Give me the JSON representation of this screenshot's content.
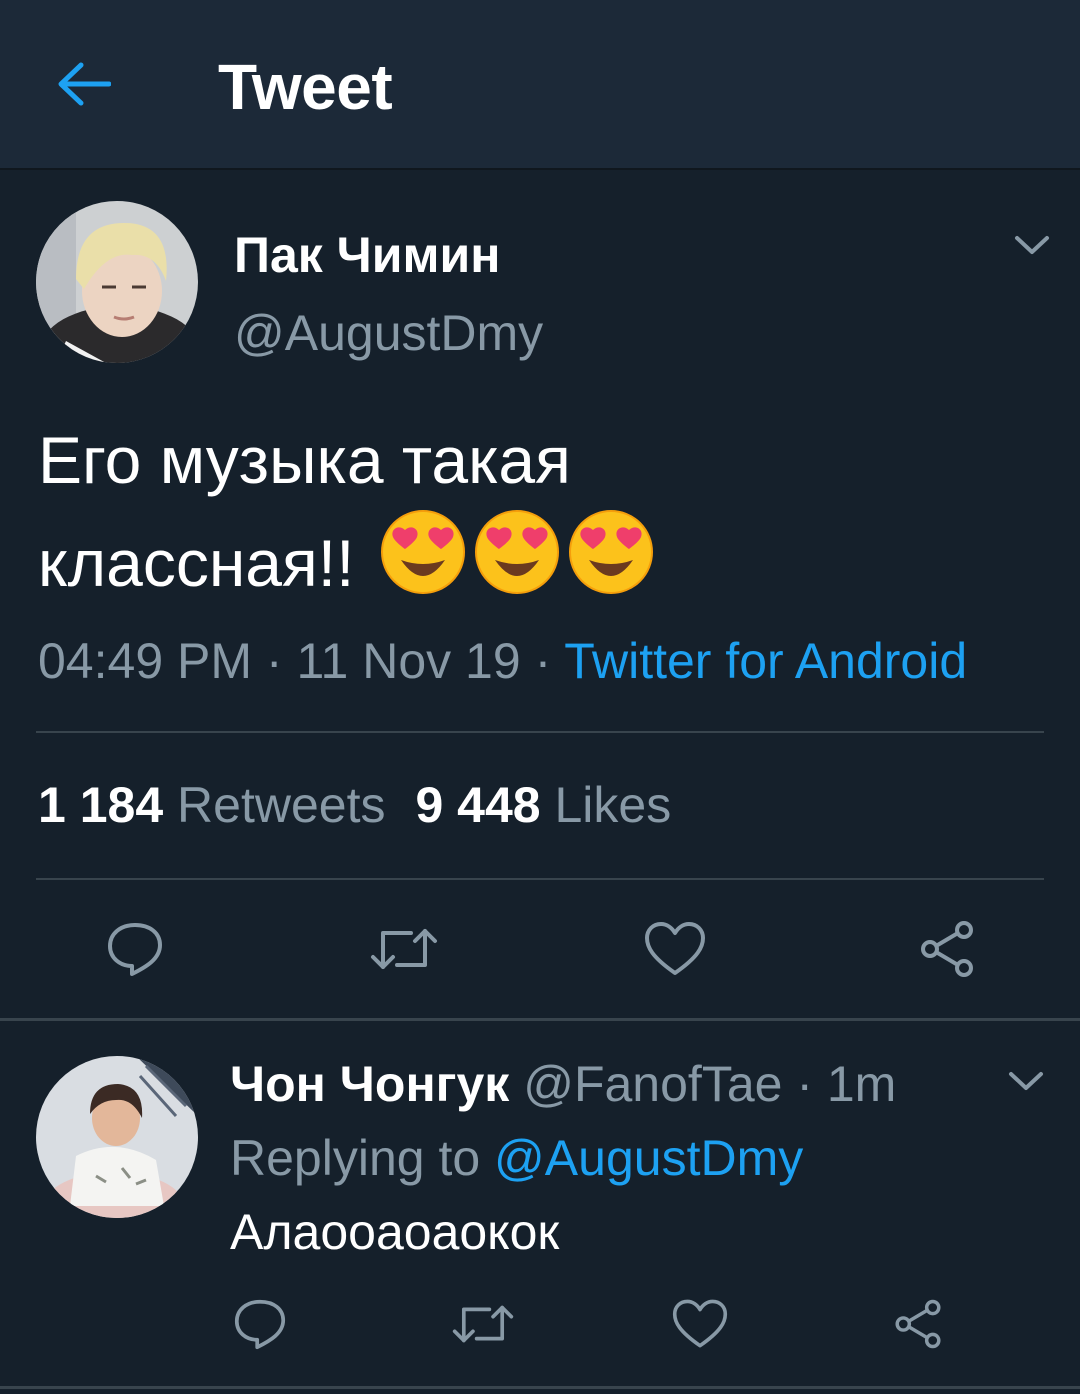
{
  "header": {
    "title": "Tweet",
    "back_icon": "arrow-left-icon"
  },
  "colors": {
    "accent": "#1da1f2",
    "background": "#15202b",
    "header_bg": "#1c2938",
    "muted": "#8899a6",
    "divider": "#38444d"
  },
  "tweet": {
    "author_name": "Пак Чимин",
    "author_handle": "@AugustDmy",
    "text_line1": "Его музыка такая",
    "text_line2": "классная!!",
    "emojis": [
      "smiling-face-with-heart-eyes",
      "smiling-face-with-heart-eyes",
      "smiling-face-with-heart-eyes"
    ],
    "time": "04:49 PM",
    "sep1": " · ",
    "date": "11 Nov 19",
    "sep2": " · ",
    "source": "Twitter for Android",
    "retweets_count": "1 184",
    "retweets_label": "Retweets",
    "likes_count": "9 448",
    "likes_label": "Likes"
  },
  "actions": [
    "reply-icon",
    "retweet-icon",
    "like-icon",
    "share-icon"
  ],
  "reply": {
    "author_name": "Чон Чонгук",
    "author_handle": "@FanofTae",
    "sep": " · ",
    "time": "1m",
    "replying_prefix": "Replying to ",
    "replying_handle": "@AugustDmy",
    "text": "Алаооаоаокок"
  }
}
